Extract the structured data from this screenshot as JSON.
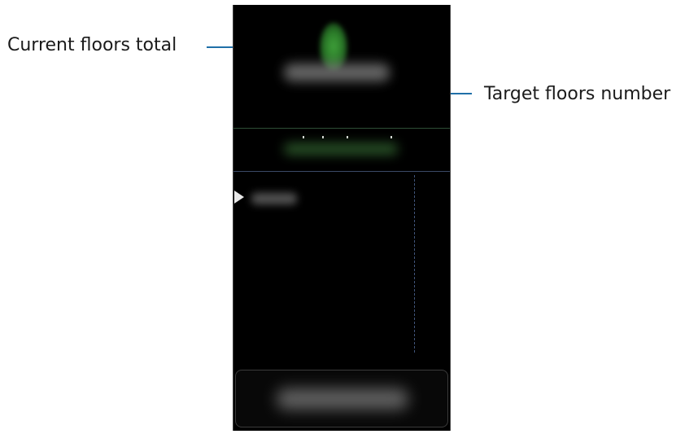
{
  "callouts": {
    "current_floors": "Current floors total",
    "target_floors": "Target floors number"
  },
  "screen": {
    "header_icon": "floors-icon",
    "accent_green": "#3fa03a",
    "accent_blue": "#1f6fa8"
  }
}
